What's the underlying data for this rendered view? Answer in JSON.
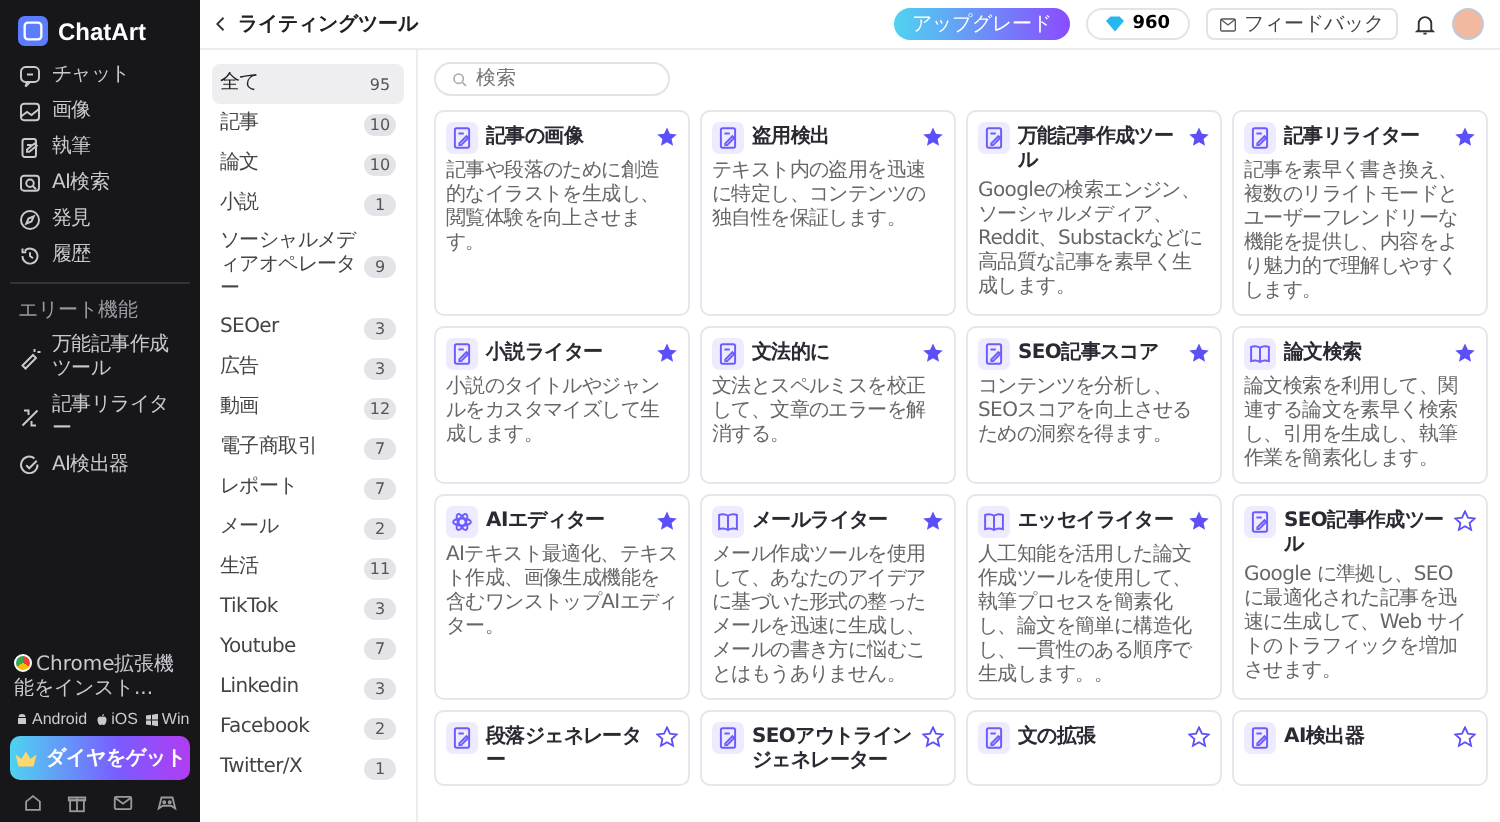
{
  "sidebar": {
    "logo": "ChatArt",
    "nav": [
      "チャット",
      "画像",
      "執筆",
      "AI検索",
      "発見",
      "履歴"
    ],
    "section_title": "エリート機能",
    "pro_items": [
      "万能記事作成ツール",
      "記事リライター",
      "AI検出器"
    ],
    "extension": "Chrome拡張機能をインスト...",
    "platforms": [
      "Android",
      "iOS",
      "Win"
    ],
    "cta": "ダイヤをゲット"
  },
  "header": {
    "title": "ライティングツール",
    "upgrade": "アップグレード",
    "credits": "960",
    "feedback": "フィードバック"
  },
  "categories": [
    {
      "label": "全て",
      "count": "95",
      "selected": true
    },
    {
      "label": "記事",
      "count": "10",
      "selected": false
    },
    {
      "label": "論文",
      "count": "10",
      "selected": false
    },
    {
      "label": "小説",
      "count": "1",
      "selected": false
    },
    {
      "label": "ソーシャルメディアオペレーター",
      "count": "9",
      "selected": false
    },
    {
      "label": "SEOer",
      "count": "3",
      "selected": false
    },
    {
      "label": "広告",
      "count": "3",
      "selected": false
    },
    {
      "label": "動画",
      "count": "12",
      "selected": false
    },
    {
      "label": "電子商取引",
      "count": "7",
      "selected": false
    },
    {
      "label": "レポート",
      "count": "7",
      "selected": false
    },
    {
      "label": "メール",
      "count": "2",
      "selected": false
    },
    {
      "label": "生活",
      "count": "11",
      "selected": false
    },
    {
      "label": "TikTok",
      "count": "3",
      "selected": false
    },
    {
      "label": "Youtube",
      "count": "7",
      "selected": false
    },
    {
      "label": "Linkedin",
      "count": "3",
      "selected": false
    },
    {
      "label": "Facebook",
      "count": "2",
      "selected": false
    },
    {
      "label": "Twitter/X",
      "count": "1",
      "selected": false
    }
  ],
  "search": {
    "placeholder": "検索"
  },
  "tools": [
    {
      "title": "記事の画像",
      "description": "記事や段落のために創造的なイラストを生成し、閲覧体験を向上させます。",
      "kind": "document",
      "favorite": true
    },
    {
      "title": "盗用検出",
      "description": "テキスト内の盗用を迅速に特定し、コンテンツの独自性を保証します。",
      "kind": "document",
      "favorite": true
    },
    {
      "title": "万能記事作成ツール",
      "description": "Googleの検索エンジン、ソーシャルメディア、Reddit、Substackなどに高品質な記事を素早く生成します。",
      "kind": "document",
      "favorite": true
    },
    {
      "title": "記事リライター",
      "description": "記事を素早く書き換え、複数のリライトモードとユーザーフレンドリーな機能を提供し、内容をより魅力的で理解しやすくします。",
      "kind": "document",
      "favorite": true
    },
    {
      "title": "小説ライター",
      "description": "小説のタイトルやジャンルをカスタマイズして生成します。",
      "kind": "document",
      "favorite": true
    },
    {
      "title": "文法的に",
      "description": "文法とスペルミスを校正して、文章のエラーを解消する。",
      "kind": "document",
      "favorite": true
    },
    {
      "title": "SEO記事スコア",
      "description": "コンテンツを分析し、SEOスコアを向上させるための洞察を得ます。",
      "kind": "document",
      "favorite": true
    },
    {
      "title": "論文検索",
      "description": "論文検索を利用して、関連する論文を素早く検索し、引用を生成し、執筆作業を簡素化します。",
      "kind": "book",
      "favorite": true
    },
    {
      "title": "AIエディター",
      "description": "AIテキスト最適化、テキスト作成、画像生成機能を含むワンストップAIエディター。",
      "kind": "atom",
      "favorite": true
    },
    {
      "title": "メールライター",
      "description": "メール作成ツールを使用して、あなたのアイデアに基づいた形式の整ったメールを迅速に生成し、メールの書き方に悩むことはもうありません。",
      "kind": "book",
      "favorite": true
    },
    {
      "title": "エッセイライター",
      "description": "人工知能を活用した論文作成ツールを使用して、執筆プロセスを簡素化し、論文を簡単に構造化し、一貫性のある順序で生成します。。",
      "kind": "book",
      "favorite": true
    },
    {
      "title": "SEO記事作成ツール",
      "description": "Google に準拠し、SEO に最適化された記事を迅速に生成して、Web サイトのトラフィックを増加させます。",
      "kind": "document",
      "favorite": false
    },
    {
      "title": "段落ジェネレーター",
      "kind": "document",
      "favorite": false
    },
    {
      "title": "SEOアウトラインジェネレーター",
      "kind": "document",
      "favorite": false
    },
    {
      "title": "文の拡張",
      "kind": "document",
      "favorite": false
    },
    {
      "title": "AI検出器",
      "kind": "document",
      "favorite": false
    }
  ]
}
